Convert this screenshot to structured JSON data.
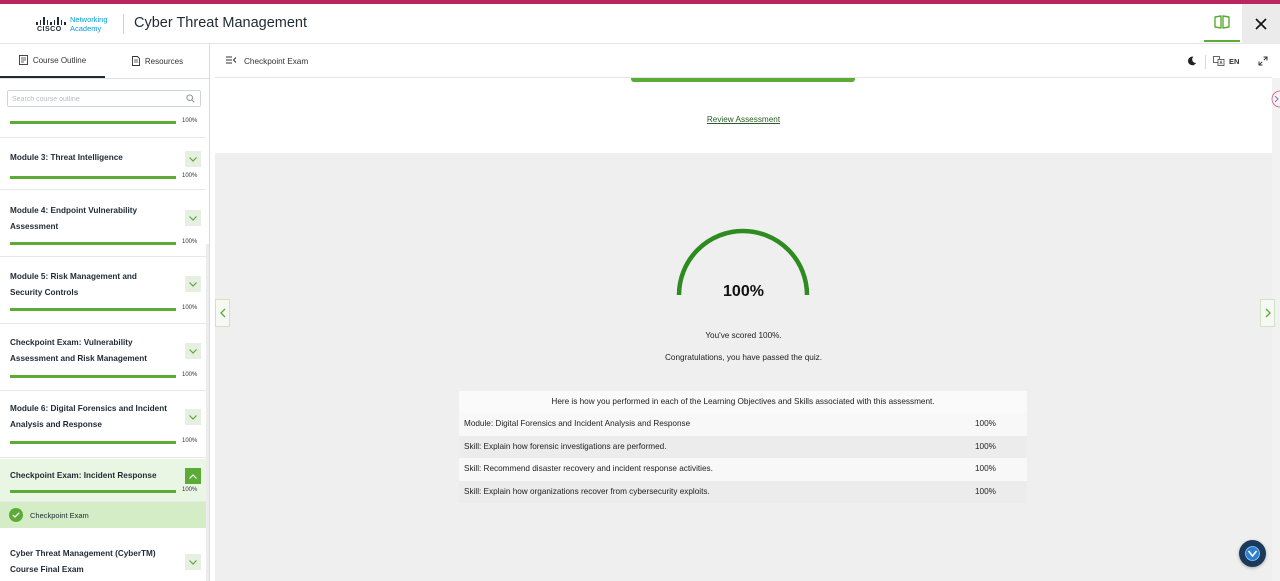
{
  "brand": {
    "logo_word": "CISCO",
    "academy_line1": "Networking",
    "academy_line2": "Academy",
    "accent_color": "#b8255f",
    "green": "#5bab36"
  },
  "header": {
    "title": "Cyber Threat Management",
    "book_icon": "book-open-icon",
    "close_icon": "close-icon"
  },
  "sidebar": {
    "tabs": [
      {
        "label": "Course Outline",
        "icon": "outline-icon",
        "active": true
      },
      {
        "label": "Resources",
        "icon": "document-icon",
        "active": false
      }
    ],
    "search": {
      "placeholder": "Search course outline",
      "value": ""
    },
    "top_progress": {
      "value": "100%",
      "fraction": 1.0
    },
    "modules": [
      {
        "title": "Module 3: Threat Intelligence",
        "progress": "100%",
        "fraction": 1.0,
        "expanded": false
      },
      {
        "title": "Module 4: Endpoint Vulnerability Assessment",
        "progress": "100%",
        "fraction": 1.0,
        "expanded": false
      },
      {
        "title": "Module 5: Risk Management and Security Controls",
        "progress": "100%",
        "fraction": 1.0,
        "expanded": false
      },
      {
        "title": "Checkpoint Exam: Vulnerability Assessment and Risk Management",
        "progress": "100%",
        "fraction": 1.0,
        "expanded": false
      },
      {
        "title": "Module 6: Digital Forensics and Incident Analysis and Response",
        "progress": "100%",
        "fraction": 1.0,
        "expanded": false
      },
      {
        "title": "Checkpoint Exam: Incident Response",
        "progress": "100%",
        "fraction": 1.0,
        "expanded": true
      },
      {
        "title": "Cyber Threat Management (CyberTM) Course Final Exam",
        "progress": "",
        "fraction": 0,
        "expanded": false
      }
    ],
    "sub_item": {
      "label": "Checkpoint Exam",
      "status": "completed"
    }
  },
  "main": {
    "breadcrumb": "Checkpoint Exam",
    "language": "EN",
    "review_link": "Review Assessment",
    "score": {
      "label": "100%",
      "fraction": 1.0
    },
    "scored_text": "You've scored 100%.",
    "congrats_text": "Congratulations, you have passed the quiz.",
    "performance": {
      "heading": "Here is how you performed in each of the Learning Objectives and Skills associated with this assessment.",
      "rows": [
        {
          "label": "Module: Digital Forensics and Incident Analysis and Response",
          "value": "100%"
        },
        {
          "label": "Skill: Explain how forensic investigations are performed.",
          "value": "100%"
        },
        {
          "label": "Skill: Recommend disaster recovery and incident response activities.",
          "value": "100%"
        },
        {
          "label": "Skill: Explain how organizations recover from cybersecurity exploits.",
          "value": "100%"
        }
      ]
    }
  }
}
